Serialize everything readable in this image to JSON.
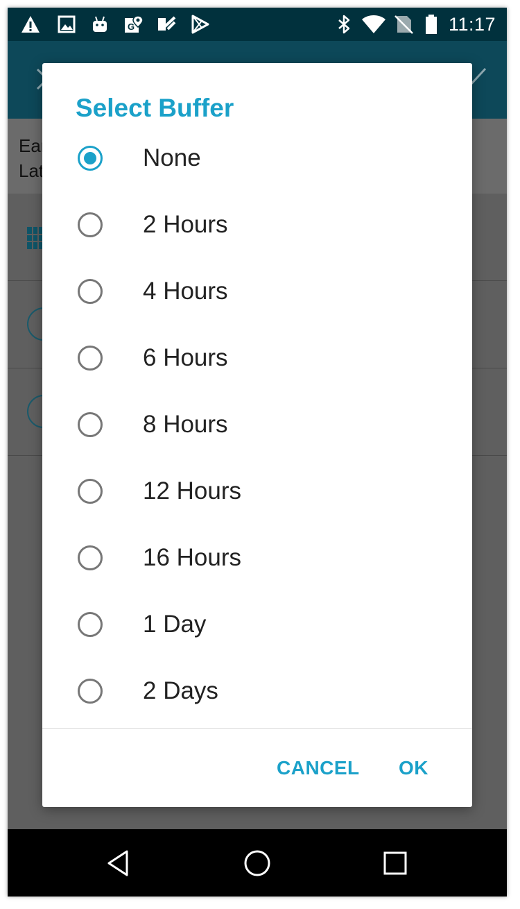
{
  "status_bar": {
    "time": "11:17",
    "left_icons": [
      "warning-icon",
      "image-icon",
      "android-icon",
      "maps-icon",
      "voucher-icon",
      "play-store-icon"
    ],
    "right_icons": [
      "bluetooth-icon",
      "wifi-icon",
      "no-sim-icon",
      "battery-icon"
    ]
  },
  "background": {
    "row1_text": "Ear",
    "row2_text": "Lat"
  },
  "dialog": {
    "title": "Select Buffer",
    "selected_index": 0,
    "options": [
      {
        "label": "None"
      },
      {
        "label": "2 Hours"
      },
      {
        "label": "4 Hours"
      },
      {
        "label": "6 Hours"
      },
      {
        "label": "8 Hours"
      },
      {
        "label": "12 Hours"
      },
      {
        "label": "16 Hours"
      },
      {
        "label": "1 Day"
      },
      {
        "label": "2 Days"
      }
    ],
    "cancel_label": "CANCEL",
    "ok_label": "OK"
  },
  "colors": {
    "accent": "#1ba1c9",
    "status_bar": "#01313d",
    "app_bar": "#0d4859",
    "scrim": "#5f5f5f"
  },
  "nav_bar": {
    "icons": [
      "back-icon",
      "home-icon",
      "recents-icon"
    ]
  }
}
